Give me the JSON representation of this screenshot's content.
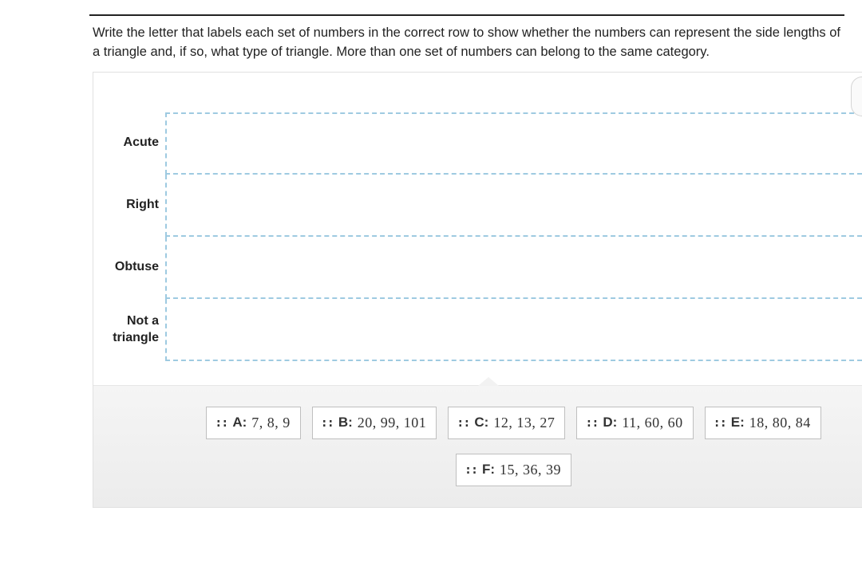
{
  "prompt": "Write the letter that labels each set of numbers in the correct row to show whether the numbers can represent the side lengths of a triangle and, if so, what type of triangle. More than one set of numbers can belong to the same category.",
  "rows": [
    {
      "label": "Acute"
    },
    {
      "label": "Right"
    },
    {
      "label": "Obtuse"
    },
    {
      "label_line1": "Not a",
      "label_line2": "triangle"
    }
  ],
  "chips": [
    {
      "letter": "A:",
      "nums": "7,  8,  9"
    },
    {
      "letter": "B:",
      "nums": "20,  99,  101"
    },
    {
      "letter": "C:",
      "nums": "12,  13,  27"
    },
    {
      "letter": "D:",
      "nums": "11,  60,  60"
    },
    {
      "letter": "E:",
      "nums": "18,  80,  84"
    },
    {
      "letter": "F:",
      "nums": "15,  36,  39"
    }
  ],
  "grip_glyph": "::"
}
